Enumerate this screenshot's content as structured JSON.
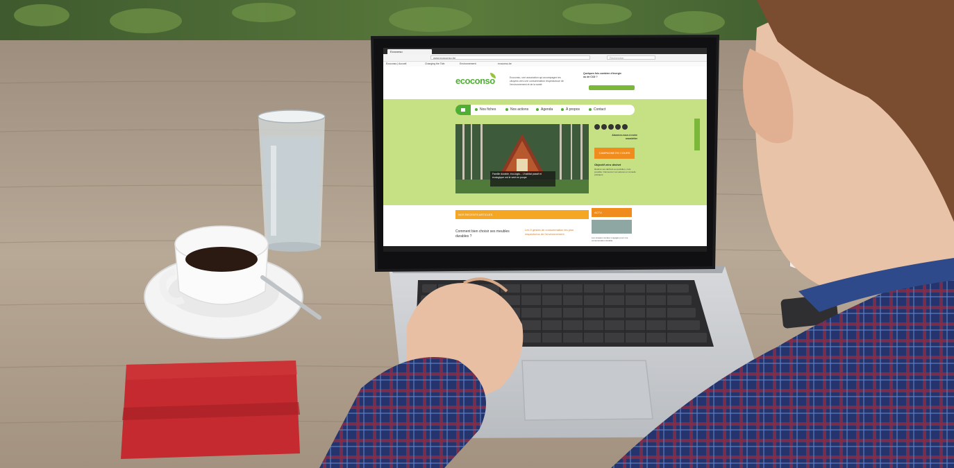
{
  "browser": {
    "tab_title": "Ecoconso",
    "url": "www.ecoconso.be",
    "search_placeholder": "Rechercher"
  },
  "bookmarks": [
    "Ecoconso | Accueil",
    "Changing the Tide",
    "Environnement",
    "ecoconso.be"
  ],
  "site": {
    "logo": "ecoconso",
    "tagline": "Ecoconso, une association qui accompagne les citoyens vers une consommation respectueuse de l'environnement et de la santé",
    "header_question": "Quelques fois combien d'énergie ou de CO2 ?",
    "nav": [
      "Nos fiches",
      "Nos actions",
      "Agenda",
      "À propos",
      "Contact"
    ],
    "hero_caption": "Famille durable, éco-logis... L'habitat passif et écologique ont le vent en poupe",
    "newsletter": "Abonnez-vous à notre newsletter",
    "campaign_button": "CAMPAGNE EN COURS",
    "side_title": "Objectif zéro déchet",
    "side_text": "Réduire ses déchets au quotidien, c'est possible ! Découvrez nos astuces et conseils pratiques.",
    "section_title": "NOS RECENTS ARTICLES",
    "side_section": "ACTU",
    "article_1": "Comment bien choisir ses meubles durables ?",
    "article_2": "Les 5 gestes de consommation les plus respectueux de l'environnement",
    "side_news": "Les réseaux sociaux engagés pour une consommation durable"
  },
  "colors": {
    "brand_green": "#4fae33",
    "band_green": "#c5e184",
    "accent_orange": "#f08c1e",
    "notebook_red": "#c42a2f"
  }
}
